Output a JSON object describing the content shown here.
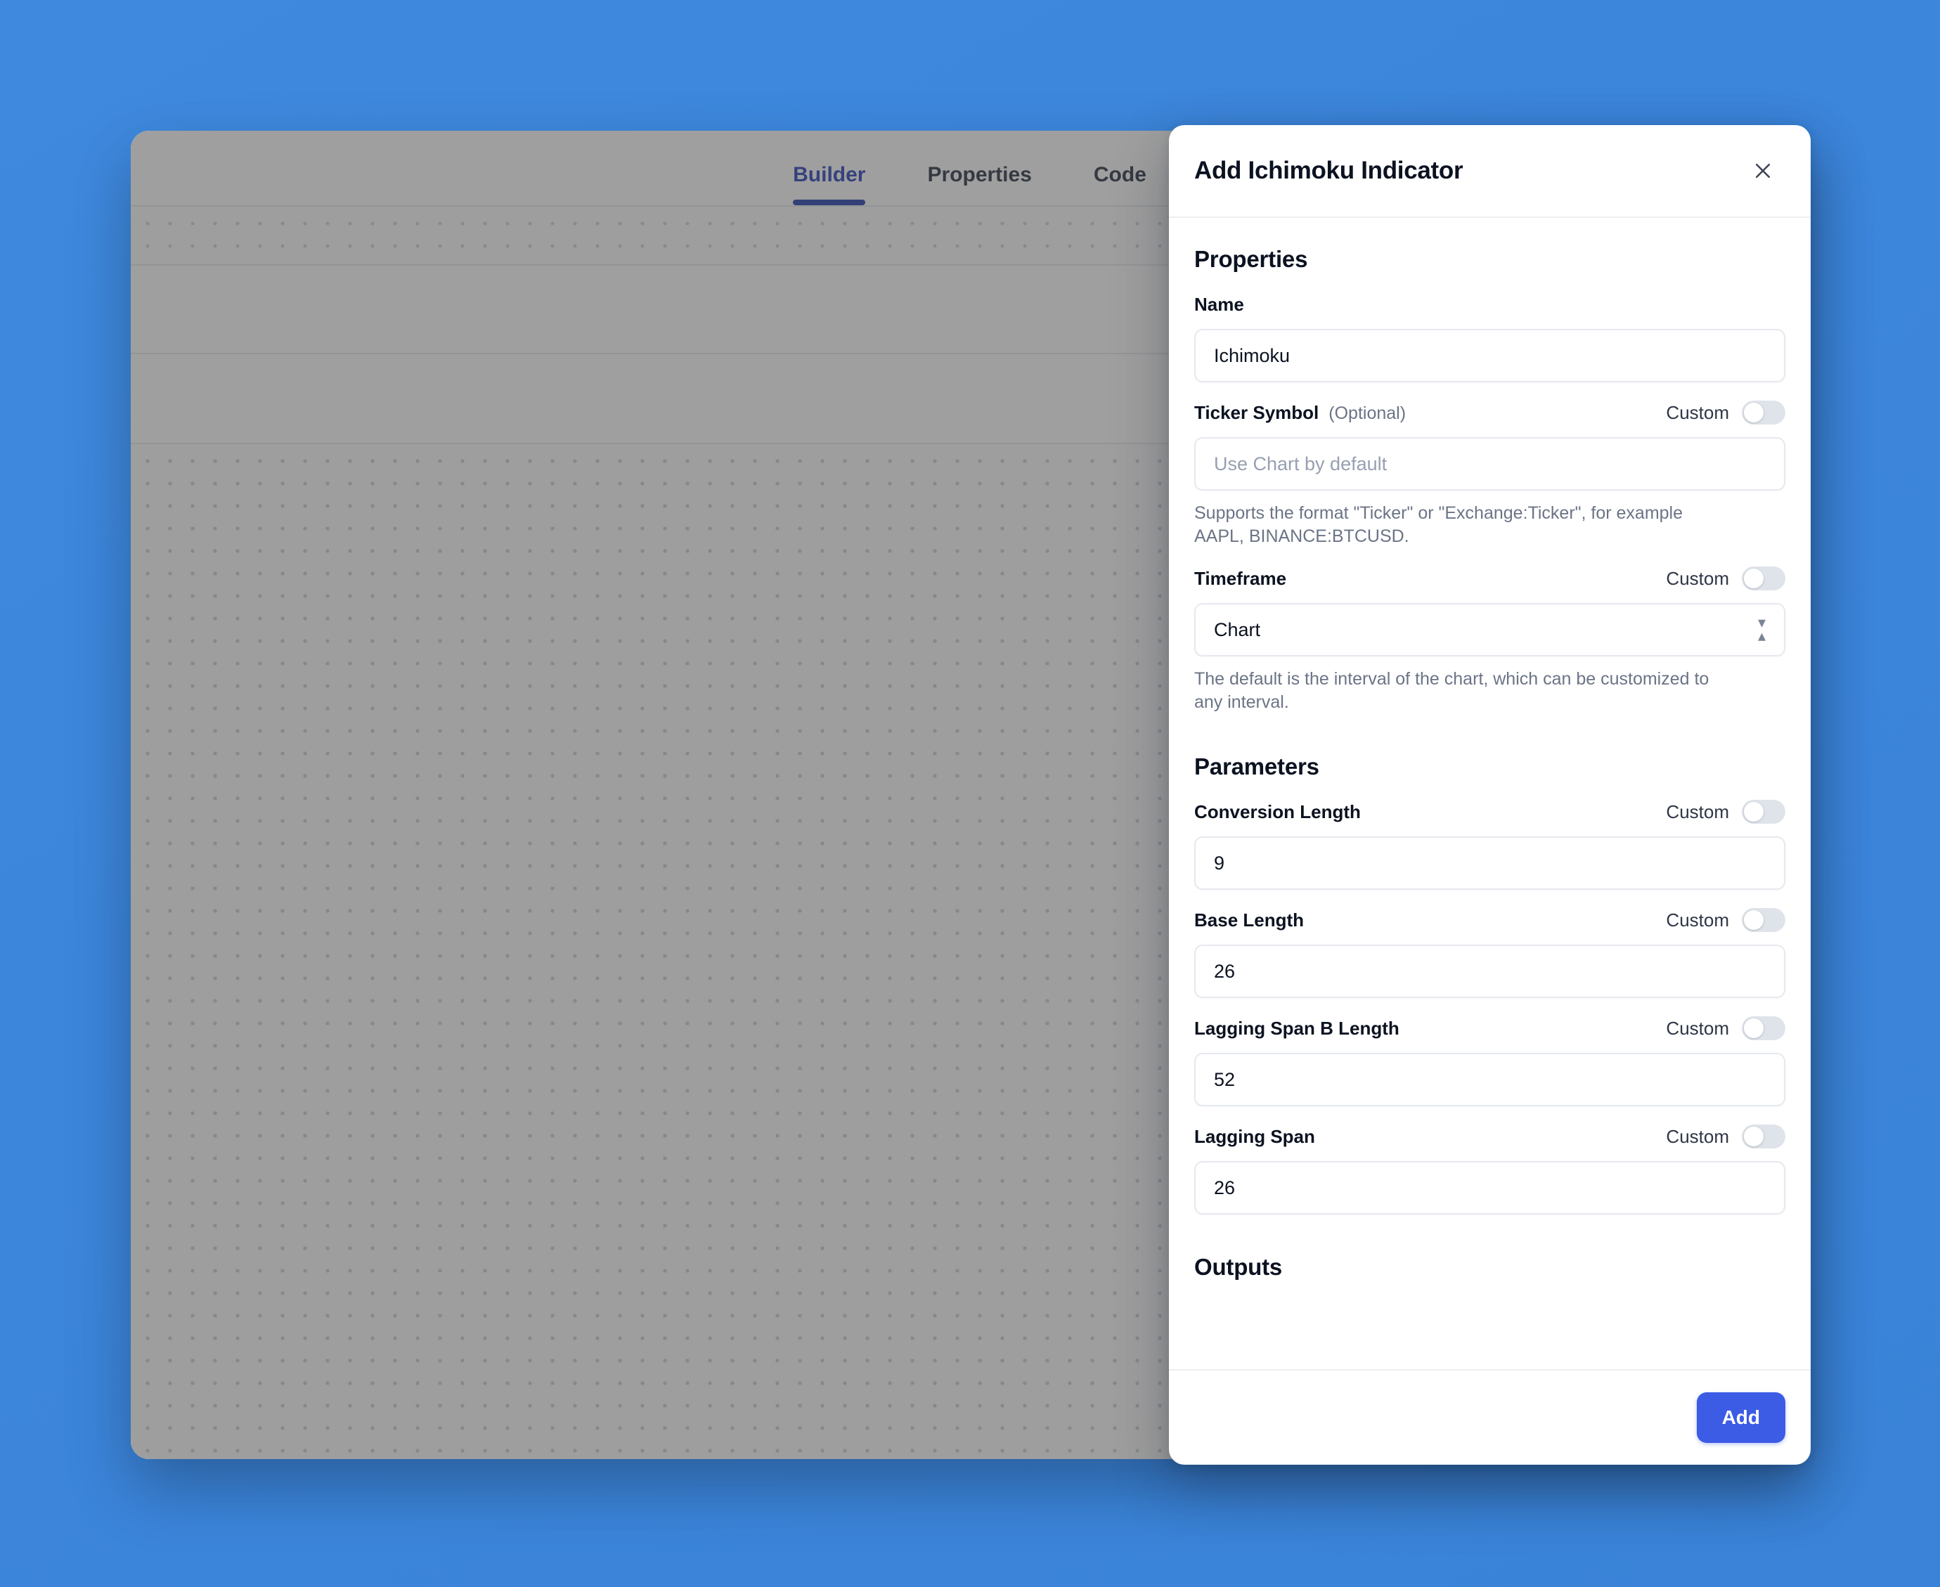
{
  "background_color": "#3c86dc",
  "app_window": {
    "tabs": [
      {
        "label": "Builder",
        "active": true
      },
      {
        "label": "Properties",
        "active": false
      },
      {
        "label": "Code",
        "active": false
      }
    ],
    "toolbar_icons": [
      {
        "name": "plus-icon",
        "glyph": "+"
      },
      {
        "name": "sort-swap-icon",
        "glyph": "⇅"
      }
    ],
    "active_tab_color": "#2540ae"
  },
  "dialog": {
    "title": "Add Ichimoku Indicator",
    "close_icon": "close-icon",
    "accent_color": "#3c5ce5",
    "properties": {
      "heading": "Properties",
      "name": {
        "label": "Name",
        "value": "Ichimoku"
      },
      "ticker_symbol": {
        "label": "Ticker Symbol",
        "optional_tag": "(Optional)",
        "custom_label": "Custom",
        "custom_on": false,
        "placeholder": "Use Chart by default",
        "value": "",
        "helper": "Supports the format \"Ticker\" or \"Exchange:Ticker\", for example AAPL, BINANCE:BTCUSD."
      },
      "timeframe": {
        "label": "Timeframe",
        "custom_label": "Custom",
        "custom_on": false,
        "value": "Chart",
        "helper": "The default is the interval of the chart, which can be customized to any interval."
      }
    },
    "parameters": {
      "heading": "Parameters",
      "items": [
        {
          "label": "Conversion Length",
          "custom_label": "Custom",
          "custom_on": false,
          "value": "9"
        },
        {
          "label": "Base Length",
          "custom_label": "Custom",
          "custom_on": false,
          "value": "26"
        },
        {
          "label": "Lagging Span B Length",
          "custom_label": "Custom",
          "custom_on": false,
          "value": "52"
        },
        {
          "label": "Lagging Span",
          "custom_label": "Custom",
          "custom_on": false,
          "value": "26"
        }
      ]
    },
    "outputs": {
      "heading": "Outputs"
    },
    "footer": {
      "add_label": "Add"
    }
  }
}
